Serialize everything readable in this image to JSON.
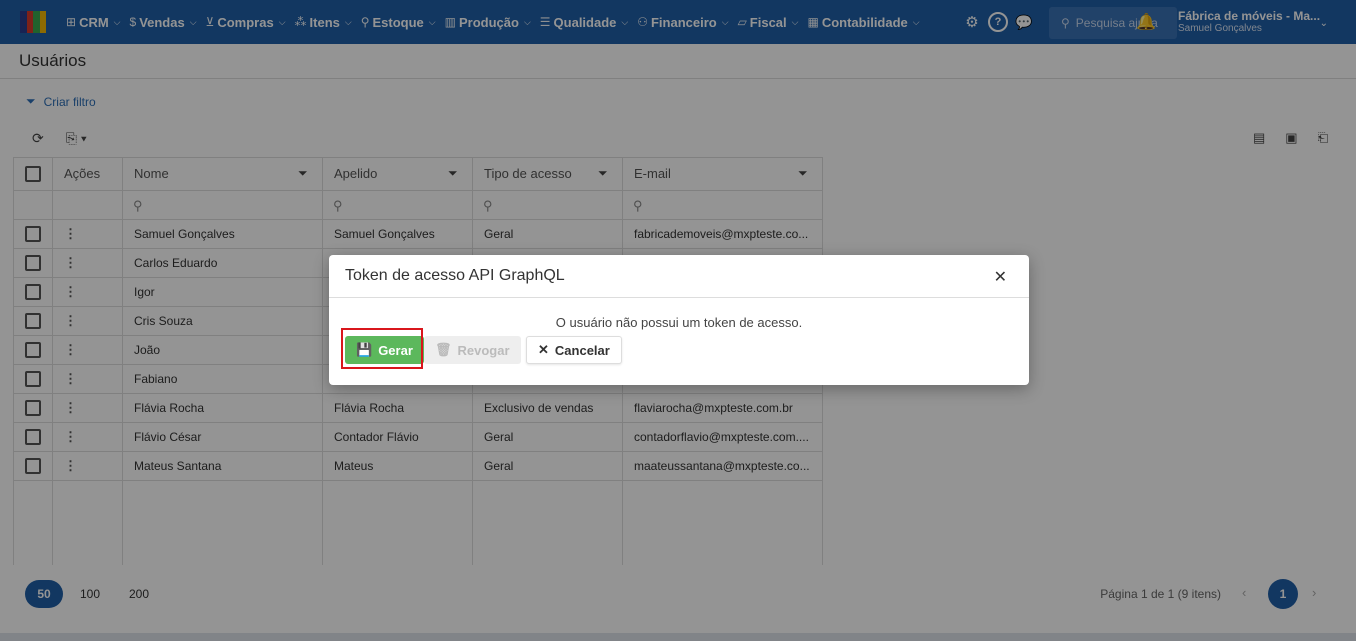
{
  "nav": {
    "logo_colors": [
      "#2a3d8f",
      "#d93a2b",
      "#3aa94e",
      "#f2b705"
    ],
    "items": [
      {
        "label": "CRM",
        "icon": "crm-icon",
        "glyph": "⊞"
      },
      {
        "label": "Vendas",
        "icon": "dollar-icon",
        "glyph": "$"
      },
      {
        "label": "Compras",
        "icon": "cart-icon",
        "glyph": "⊻"
      },
      {
        "label": "Itens",
        "icon": "items-icon",
        "glyph": "⁂"
      },
      {
        "label": "Estoque",
        "icon": "stock-icon",
        "glyph": "⚲"
      },
      {
        "label": "Produção",
        "icon": "factory-icon",
        "glyph": "▥"
      },
      {
        "label": "Qualidade",
        "icon": "quality-icon",
        "glyph": "☰"
      },
      {
        "label": "Financeiro",
        "icon": "finance-icon",
        "glyph": "⚇"
      },
      {
        "label": "Fiscal",
        "icon": "fiscal-icon",
        "glyph": "▱"
      },
      {
        "label": "Contabilidade",
        "icon": "accounting-icon",
        "glyph": "▦"
      }
    ],
    "search_placeholder": "Pesquisa ajuda",
    "company_name": "Fábrica de móveis - Ma...",
    "user_name": "Samuel Gonçalves"
  },
  "page": {
    "title": "Usuários",
    "filter_link": "Criar filtro"
  },
  "grid": {
    "columns": {
      "acoes": "Ações",
      "nome": "Nome",
      "apelido": "Apelido",
      "tipo": "Tipo de acesso",
      "email": "E-mail"
    },
    "rows": [
      {
        "nome": "Samuel Gonçalves",
        "apelido": "Samuel Gonçalves",
        "tipo": "Geral",
        "email": "fabricademoveis@mxpteste.co..."
      },
      {
        "nome": "Carlos Eduardo",
        "apelido": "",
        "tipo": "",
        "email": ""
      },
      {
        "nome": "Igor",
        "apelido": "",
        "tipo": "",
        "email": ""
      },
      {
        "nome": "Cris Souza",
        "apelido": "",
        "tipo": "",
        "email": ""
      },
      {
        "nome": "João",
        "apelido": "",
        "tipo": "",
        "email": ""
      },
      {
        "nome": "Fabiano",
        "apelido": "",
        "tipo": "",
        "email": ""
      },
      {
        "nome": "Flávia Rocha",
        "apelido": "Flávia Rocha",
        "tipo": "Exclusivo de vendas",
        "email": "flaviarocha@mxpteste.com.br"
      },
      {
        "nome": "Flávio César",
        "apelido": "Contador Flávio",
        "tipo": "Geral",
        "email": "contadorflavio@mxpteste.com...."
      },
      {
        "nome": "Mateus Santana",
        "apelido": "Mateus",
        "tipo": "Geral",
        "email": "maateussantana@mxpteste.co..."
      }
    ]
  },
  "pager": {
    "sizes": [
      "50",
      "100",
      "200"
    ],
    "active_size": "50",
    "info": "Página 1 de 1 (9 itens)",
    "current_page": "1"
  },
  "modal": {
    "title": "Token de acesso API GraphQL",
    "message": "O usuário não possui um token de acesso.",
    "gerar": "Gerar",
    "revogar": "Revogar",
    "cancelar": "Cancelar"
  },
  "colors": {
    "brand": "#1f5fa8",
    "success": "#5cb85c",
    "highlight": "#d9161c"
  }
}
